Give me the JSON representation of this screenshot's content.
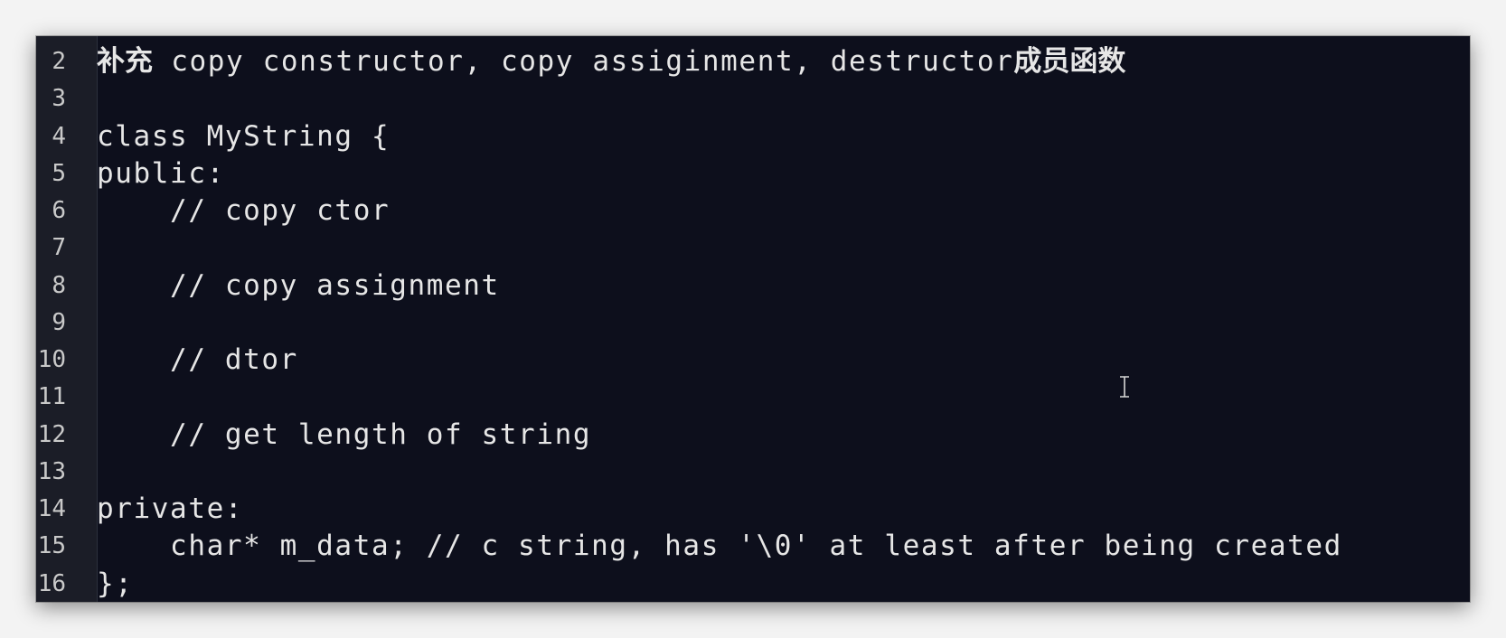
{
  "editor": {
    "lines": [
      {
        "num": "2",
        "prefix": "补充",
        "text": " copy constructor, copy assiginment, destructor",
        "suffix": "成员函数"
      },
      {
        "num": "3",
        "prefix": "",
        "text": "",
        "suffix": ""
      },
      {
        "num": "4",
        "prefix": "",
        "text": "class MyString {",
        "suffix": ""
      },
      {
        "num": "5",
        "prefix": "",
        "text": "public:",
        "suffix": ""
      },
      {
        "num": "6",
        "prefix": "",
        "text": "    // copy ctor",
        "suffix": ""
      },
      {
        "num": "7",
        "prefix": "",
        "text": "",
        "suffix": ""
      },
      {
        "num": "8",
        "prefix": "",
        "text": "    // copy assignment",
        "suffix": ""
      },
      {
        "num": "9",
        "prefix": "",
        "text": "",
        "suffix": ""
      },
      {
        "num": "10",
        "prefix": "",
        "text": "    // dtor",
        "suffix": ""
      },
      {
        "num": "11",
        "prefix": "",
        "text": "",
        "suffix": ""
      },
      {
        "num": "12",
        "prefix": "",
        "text": "    // get length of string",
        "suffix": ""
      },
      {
        "num": "13",
        "prefix": "",
        "text": "",
        "suffix": ""
      },
      {
        "num": "14",
        "prefix": "",
        "text": "private:",
        "suffix": ""
      },
      {
        "num": "15",
        "prefix": "",
        "text": "    char* m_data; // c string, has '\\0' at least after being created",
        "suffix": ""
      },
      {
        "num": "16",
        "prefix": "",
        "text": "};",
        "suffix": ""
      }
    ]
  },
  "cursor": {
    "icon": "text-cursor-icon"
  },
  "colors": {
    "background": "#0d0f1c",
    "gutter": "#1b1d27",
    "text": "#e6e6e6",
    "line_number": "#c9c9c9"
  }
}
